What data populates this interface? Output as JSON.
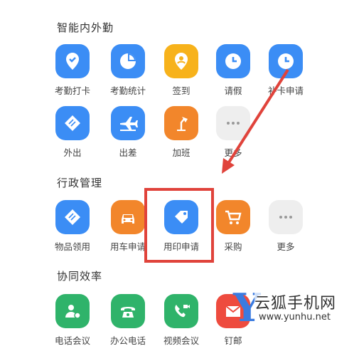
{
  "sections": {
    "attendance": {
      "title": "智能内外勤",
      "apps": [
        {
          "label": "考勤打卡",
          "icon": "location-check-icon"
        },
        {
          "label": "考勤统计",
          "icon": "pie-chart-icon"
        },
        {
          "label": "签到",
          "icon": "location-pin-icon"
        },
        {
          "label": "请假",
          "icon": "clock-icon"
        },
        {
          "label": "补卡申请",
          "icon": "clock-icon"
        },
        {
          "label": "外出",
          "icon": "diamond-icon"
        },
        {
          "label": "出差",
          "icon": "airplane-icon"
        },
        {
          "label": "加班",
          "icon": "desk-lamp-icon"
        },
        {
          "label": "更多",
          "icon": "more-dots-icon"
        }
      ]
    },
    "admin": {
      "title": "行政管理",
      "apps": [
        {
          "label": "物品领用",
          "icon": "diamond-icon"
        },
        {
          "label": "用车申请",
          "icon": "car-icon"
        },
        {
          "label": "用印申请",
          "icon": "stamp-tag-icon"
        },
        {
          "label": "采购",
          "icon": "cart-icon"
        },
        {
          "label": "更多",
          "icon": "more-dots-icon"
        }
      ]
    },
    "collab": {
      "title": "协同效率",
      "apps": [
        {
          "label": "电话会议",
          "icon": "conference-call-icon"
        },
        {
          "label": "办公电话",
          "icon": "telephone-icon"
        },
        {
          "label": "视频会议",
          "icon": "video-call-icon"
        },
        {
          "label": "钉邮",
          "icon": "mail-icon"
        }
      ]
    }
  },
  "annotation": {
    "color": "#e0433b"
  },
  "watermark": {
    "title": "云狐手机网",
    "url": "www.yunhu.net"
  }
}
